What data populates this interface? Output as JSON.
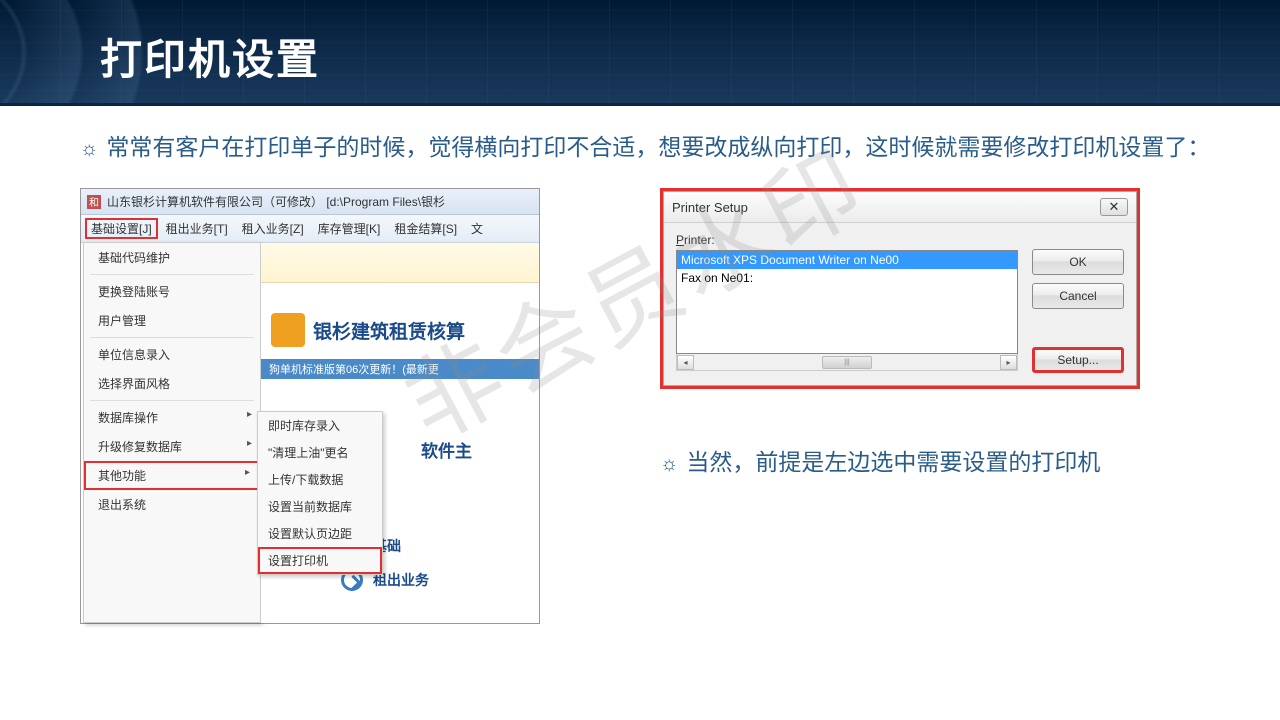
{
  "slide": {
    "title": "打印机设置",
    "bullet1": "常常有客户在打印单子的时候，觉得横向打印不合适，想要改成纵向打印，这时候就需要修改打印机设置了：",
    "bullet2": "当然，前提是左边选中需要设置的打印机",
    "watermark": "非会员水印"
  },
  "app": {
    "titlebar": "山东银杉计算机软件有限公司（可修改）     [d:\\Program Files\\银杉",
    "icon_text": "和",
    "menus": [
      "基础设置[J]",
      "租出业务[T]",
      "租入业务[Z]",
      "库存管理[K]",
      "租金结算[S]",
      "文"
    ],
    "dropdown": {
      "group1": [
        "基础代码维护"
      ],
      "group2": [
        "更换登陆账号",
        "用户管理"
      ],
      "group3": [
        "单位信息录入",
        "选择界面风格"
      ],
      "group4": [
        "数据库操作",
        "升级修复数据库",
        "其他功能",
        "退出系统"
      ]
    },
    "submenu": [
      "即时库存录入",
      "\"清理上油\"更名",
      "上传/下载数据",
      "设置当前数据库",
      "设置默认页边距",
      "设置打印机"
    ],
    "banner_title": "银杉建筑租赁核算",
    "banner_sub": "狗单机标准版第06次更新！(最新更",
    "sw_title": "软件主",
    "sidebar": {
      "i1": "基础",
      "i2": "租出业务"
    }
  },
  "dialog": {
    "title": "Printer Setup",
    "label_prefix": "P",
    "label_text": "rinter:",
    "items": [
      "Microsoft XPS Document Writer on Ne00",
      "Fax on Ne01:"
    ],
    "buttons": {
      "ok": "OK",
      "cancel": "Cancel",
      "setup": "Setup..."
    },
    "thumb": "|||"
  }
}
